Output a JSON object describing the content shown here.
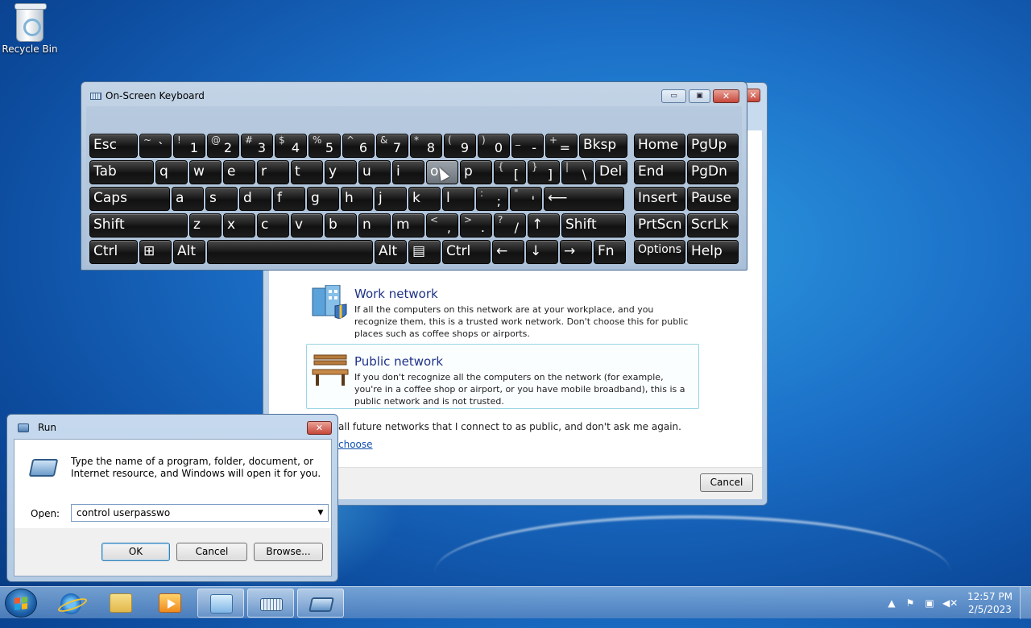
{
  "desktop": {
    "recycle_bin_label": "Recycle Bin"
  },
  "network_dialog": {
    "work_title": "Work network",
    "work_desc": "If all the computers on this network are at your workplace, and you recognize them, this is a trusted work network.  Don't choose this for public places such as coffee shops or airports.",
    "public_title": "Public network",
    "public_desc": "If you don't recognize all the computers on the network (for example, you're in a coffee shop or airport, or you have mobile broadband), this is a public network and is not trusted.",
    "future_networks_text": "all future networks that I connect to as public, and don't ask me again.",
    "help_link": "choose",
    "cancel_label": "Cancel"
  },
  "osk": {
    "title": "On-Screen Keyboard",
    "window_buttons": {
      "minimize": "▭",
      "restore": "▣",
      "close": "✕"
    },
    "rows": [
      [
        {
          "l": "Esc"
        },
        {
          "t": "~",
          "b": "`"
        },
        {
          "t": "!",
          "b": "1"
        },
        {
          "t": "@",
          "b": "2"
        },
        {
          "t": "#",
          "b": "3"
        },
        {
          "t": "$",
          "b": "4"
        },
        {
          "t": "%",
          "b": "5"
        },
        {
          "t": "^",
          "b": "6"
        },
        {
          "t": "&",
          "b": "7"
        },
        {
          "t": "*",
          "b": "8"
        },
        {
          "t": "(",
          "b": "9"
        },
        {
          "t": ")",
          "b": "0"
        },
        {
          "t": "_",
          "b": "-"
        },
        {
          "t": "+",
          "b": "="
        },
        {
          "l": "Bksp"
        },
        {
          "l": "Home"
        },
        {
          "l": "PgUp"
        }
      ],
      [
        {
          "l": "Tab"
        },
        {
          "l": "q"
        },
        {
          "l": "w"
        },
        {
          "l": "e"
        },
        {
          "l": "r"
        },
        {
          "l": "t"
        },
        {
          "l": "y"
        },
        {
          "l": "u"
        },
        {
          "l": "i"
        },
        {
          "l": "o"
        },
        {
          "l": "p"
        },
        {
          "t": "{",
          "b": "["
        },
        {
          "t": "}",
          "b": "]"
        },
        {
          "t": "|",
          "b": "\\"
        },
        {
          "l": "Del"
        },
        {
          "l": "End"
        },
        {
          "l": "PgDn"
        }
      ],
      [
        {
          "l": "Caps"
        },
        {
          "l": "a"
        },
        {
          "l": "s"
        },
        {
          "l": "d"
        },
        {
          "l": "f"
        },
        {
          "l": "g"
        },
        {
          "l": "h"
        },
        {
          "l": "j"
        },
        {
          "l": "k"
        },
        {
          "l": "l"
        },
        {
          "t": ":",
          "b": ";"
        },
        {
          "t": "\"",
          "b": "'"
        },
        {
          "l": "⟵"
        },
        {
          "l": "Insert"
        },
        {
          "l": "Pause"
        }
      ],
      [
        {
          "l": "Shift"
        },
        {
          "l": "z"
        },
        {
          "l": "x"
        },
        {
          "l": "c"
        },
        {
          "l": "v"
        },
        {
          "l": "b"
        },
        {
          "l": "n"
        },
        {
          "l": "m"
        },
        {
          "t": "<",
          "b": ","
        },
        {
          "t": ">",
          "b": "."
        },
        {
          "t": "?",
          "b": "/"
        },
        {
          "l": "↑"
        },
        {
          "l": "Shift"
        },
        {
          "l": "PrtScn"
        },
        {
          "l": "ScrLk"
        }
      ],
      [
        {
          "l": "Ctrl"
        },
        {
          "l": "⊞"
        },
        {
          "l": "Alt"
        },
        {
          "l": ""
        },
        {
          "l": "Alt"
        },
        {
          "l": "▤"
        },
        {
          "l": "Ctrl"
        },
        {
          "l": "←"
        },
        {
          "l": "↓"
        },
        {
          "l": "→"
        },
        {
          "l": "Fn"
        },
        {
          "l": "Options"
        },
        {
          "l": "Help"
        }
      ]
    ]
  },
  "run_dialog": {
    "title": "Run",
    "description": "Type the name of a program, folder, document, or Internet resource, and Windows will open it for you.",
    "open_label": "Open:",
    "input_value": "control userpasswo",
    "ok_label": "OK",
    "cancel_label": "Cancel",
    "browse_label": "Browse..."
  },
  "taskbar": {
    "clock_time": "12:57 PM",
    "clock_date": "2/5/2023"
  }
}
